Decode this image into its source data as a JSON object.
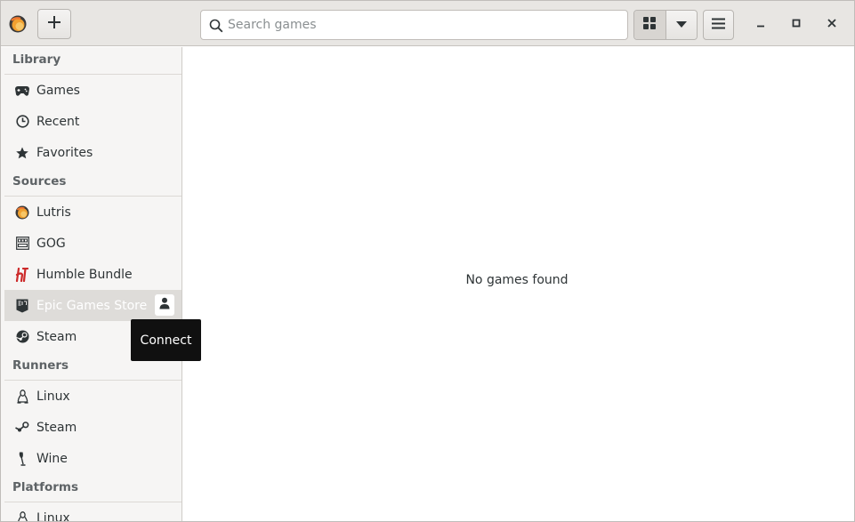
{
  "header": {
    "add_label": "+",
    "search_placeholder": "Search games",
    "search_value": ""
  },
  "sidebar": {
    "sections": {
      "library": "Library",
      "sources": "Sources",
      "runners": "Runners",
      "platforms": "Platforms"
    },
    "library": [
      {
        "label": "Games",
        "icon": "gamepad-icon"
      },
      {
        "label": "Recent",
        "icon": "clock-icon"
      },
      {
        "label": "Favorites",
        "icon": "star-icon"
      }
    ],
    "sources": [
      {
        "label": "Lutris",
        "icon": "lutris-icon"
      },
      {
        "label": "GOG",
        "icon": "gog-icon"
      },
      {
        "label": "Humble Bundle",
        "icon": "humble-icon"
      },
      {
        "label": "Epic Games Store",
        "icon": "epic-icon"
      },
      {
        "label": "Steam",
        "icon": "steam-icon"
      }
    ],
    "runners": [
      {
        "label": "Linux",
        "icon": "linux-icon"
      },
      {
        "label": "Steam",
        "icon": "steam-icon"
      },
      {
        "label": "Wine",
        "icon": "wine-icon"
      }
    ],
    "platforms": [
      {
        "label": "Linux",
        "icon": "linux-icon"
      }
    ]
  },
  "tooltip": {
    "text": "Connect"
  },
  "main": {
    "empty_text": "No games found"
  },
  "colors": {
    "header_bg": "#e8e6e3",
    "sidebar_bg": "#f6f5f4",
    "selected_bg": "#dedcd9",
    "lutris_orange": "#f0a030",
    "humble_red": "#cc2929",
    "tooltip_bg": "#101010"
  }
}
